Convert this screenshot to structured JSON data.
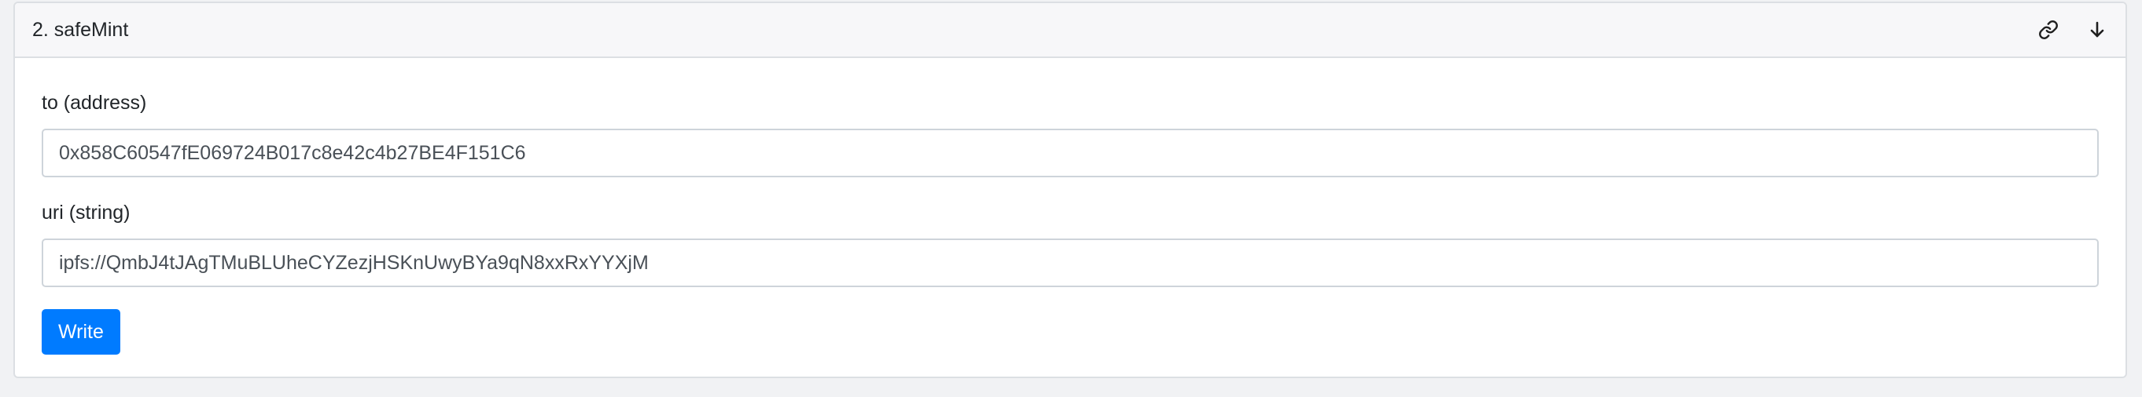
{
  "function": {
    "title": "2. safeMint",
    "icons": {
      "link": "link-icon",
      "expand": "arrow-down-icon"
    }
  },
  "inputs": [
    {
      "label": "to (address)",
      "value": "0x858C60547fE069724B017c8e42c4b27BE4F151C6"
    },
    {
      "label": "uri (string)",
      "value": "ipfs://QmbJ4tJAgTMuBLUheCYZezjHSKnUwyBYa9qN8xxRxYYXjM"
    }
  ],
  "actions": {
    "write_label": "Write"
  },
  "colors": {
    "primary": "#007bff",
    "header_bg": "#f7f7f9",
    "border": "#dcdfe3"
  }
}
